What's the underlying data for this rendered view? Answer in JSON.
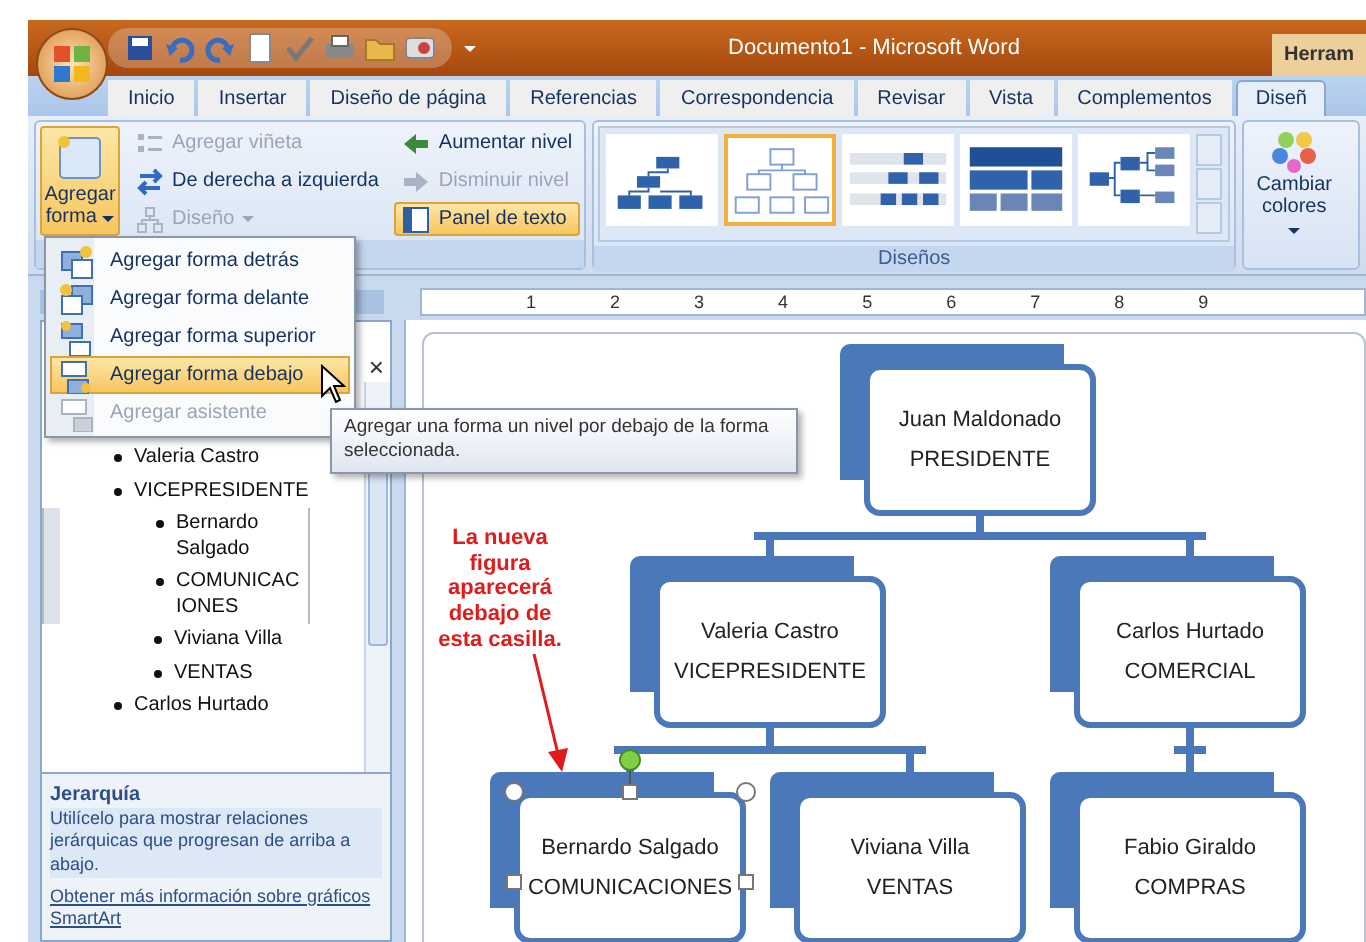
{
  "title_bar": {
    "title": "Documento1 - Microsoft Word",
    "context_label": "Herram"
  },
  "tabs": [
    {
      "label": "Inicio",
      "selected": false
    },
    {
      "label": "Insertar",
      "selected": false
    },
    {
      "label": "Diseño de página",
      "selected": false
    },
    {
      "label": "Referencias",
      "selected": false
    },
    {
      "label": "Correspondencia",
      "selected": false
    },
    {
      "label": "Revisar",
      "selected": false
    },
    {
      "label": "Vista",
      "selected": false
    },
    {
      "label": "Complementos",
      "selected": false
    },
    {
      "label": "Diseñ",
      "selected": true
    }
  ],
  "ribbon": {
    "add_shape": {
      "label": "Agregar forma",
      "on": true
    },
    "column_1": [
      {
        "label": "Agregar viñeta",
        "kind": "bullet",
        "disabled": true
      },
      {
        "label": "De derecha a izquierda",
        "kind": "swap",
        "disabled": false
      },
      {
        "label": "Diseño",
        "kind": "layout",
        "disabled": true
      }
    ],
    "column_2": [
      {
        "label": "Aumentar nivel",
        "kind": "promote",
        "disabled": false,
        "on": false
      },
      {
        "label": "Disminuir nivel",
        "kind": "demote",
        "disabled": true,
        "on": false
      },
      {
        "label": "Panel de texto",
        "kind": "pane",
        "disabled": false,
        "on": true
      }
    ],
    "layouts": {
      "label": "Diseños",
      "items": [
        {
          "kind": "hierarchy",
          "selected": false
        },
        {
          "kind": "outline",
          "selected": true
        },
        {
          "kind": "labeled",
          "selected": false
        },
        {
          "kind": "table",
          "selected": false
        },
        {
          "kind": "horizontal",
          "selected": false
        }
      ]
    },
    "colors": {
      "label": "Cambiar colores"
    }
  },
  "ruler": {
    "numbers": [
      "1",
      "2",
      "3",
      "4",
      "5",
      "6",
      "7",
      "8",
      "9"
    ]
  },
  "menu": {
    "items": [
      {
        "label": "Agregar forma detrás",
        "kind": "behind",
        "selected": false,
        "disabled": false
      },
      {
        "label": "Agregar forma delante",
        "kind": "ahead",
        "selected": false,
        "disabled": false
      },
      {
        "label": "Agregar forma superior",
        "kind": "above",
        "selected": false,
        "disabled": false
      },
      {
        "label": "Agregar forma debajo",
        "kind": "below",
        "selected": true,
        "disabled": false
      },
      {
        "label": "Agregar asistente",
        "kind": "assistant",
        "selected": false,
        "disabled": true
      }
    ]
  },
  "tooltip": {
    "text": "Agregar una forma un nivel por debajo de la forma seleccionada."
  },
  "text_pane": {
    "close": "×",
    "items": [
      {
        "text": "Valeria Castro",
        "selected": false
      },
      {
        "text": "VICEPRESIDENTE",
        "selected": false,
        "children": [
          {
            "text": "Bernardo Salgado",
            "selected": true
          },
          {
            "text": "COMUNICACIONES",
            "selected": true
          },
          {
            "text": "Viviana Villa",
            "selected": false
          },
          {
            "text": "VENTAS",
            "selected": false
          }
        ]
      },
      {
        "text": "Carlos Hurtado",
        "selected": false
      }
    ],
    "info": {
      "title": "Jerarquía",
      "description": "Utilícelo para mostrar relaciones jerárquicas que progresan de arriba a abajo.",
      "link": "Obtener más información sobre gráficos SmartArt"
    }
  },
  "chart": {
    "callout": "La nueva figura aparecerá debajo de esta casilla.",
    "root": {
      "name": "Juan Maldonado",
      "role": "PRESIDENTE",
      "selected": false,
      "children": [
        {
          "name": "Valeria Castro",
          "role": "VICEPRESIDENTE",
          "selected": false,
          "children": [
            {
              "name": "Bernardo Salgado",
              "role": "COMUNICACIONES",
              "selected": true
            },
            {
              "name": "Viviana Villa",
              "role": "VENTAS",
              "selected": false
            }
          ]
        },
        {
          "name": "Carlos Hurtado",
          "role": "COMERCIAL",
          "selected": false,
          "children": [
            {
              "name": "Fabio Giraldo",
              "role": "COMPRAS",
              "selected": false
            }
          ]
        }
      ]
    }
  }
}
